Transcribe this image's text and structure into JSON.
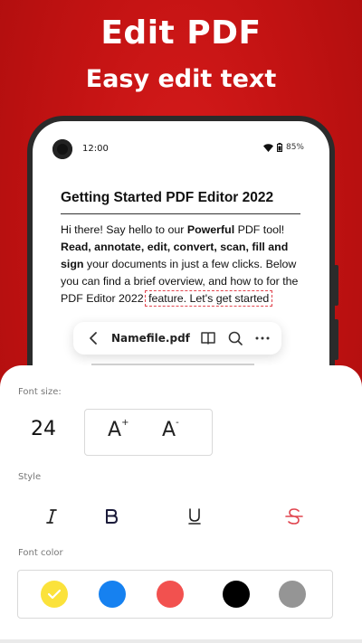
{
  "hero": {
    "title": "Edit PDF",
    "subtitle": "Easy edit text"
  },
  "status_bar": {
    "time": "12:00",
    "battery": "85%"
  },
  "document": {
    "title": "Getting Started PDF Editor 2022",
    "p1": "Hi there! Say hello to our ",
    "p1_bold": "Powerful",
    "p2": " PDF tool! ",
    "p2_bold": "Read, annotate, edit, convert, scan, fill and sign",
    "p3": " your documents in just a few clicks. Below you can find a brief overview, and how to for the PDF Editor 2022",
    "selected": "feature. Let's get started"
  },
  "toolbar": {
    "filename": "Namefile.pdf"
  },
  "sheet": {
    "font_size_label": "Font size:",
    "font_size_value": "24",
    "increase_label": "A",
    "decrease_label": "A",
    "style_label": "Style",
    "font_color_label": "Font color",
    "colors": [
      "#FBE23B",
      "#1681F0",
      "#F2514F",
      "#000000",
      "#959595"
    ],
    "accent": "#E0454F"
  }
}
